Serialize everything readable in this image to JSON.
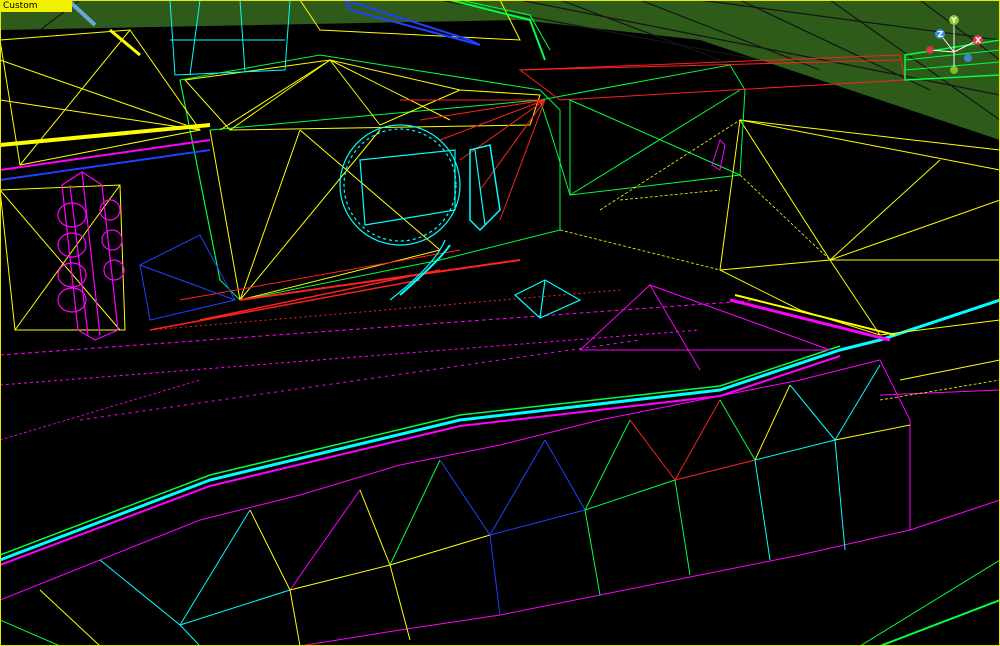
{
  "viewport": {
    "view_label": "Custom"
  },
  "gizmo": {
    "y_label": "Y",
    "z_label": "Z",
    "x_label": "X",
    "colors": {
      "x": "#e8344a",
      "y": "#8ccc2a",
      "z": "#3b8fe0"
    }
  },
  "wire_colors": [
    "#ffff00",
    "#ff00ff",
    "#00ffff",
    "#00ff40",
    "#ff2020",
    "#2040ff"
  ],
  "ground_color": "#2e5a1a"
}
